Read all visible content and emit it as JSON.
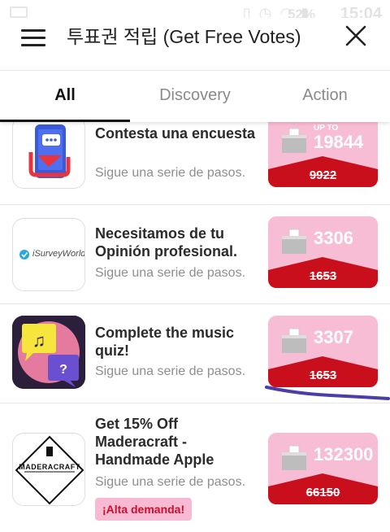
{
  "status_bar": {
    "battery": "52%",
    "time": "15:04"
  },
  "header": {
    "title": "투표권 적립 (Get Free Votes)",
    "menu_icon": "hamburger-icon",
    "close_icon": "close-icon"
  },
  "tabs": [
    {
      "label": "All",
      "active": true
    },
    {
      "label": "Discovery",
      "active": false
    },
    {
      "label": "Action",
      "active": false
    }
  ],
  "offers": [
    {
      "title": "Contesta una encuesta",
      "subtitle": "Sigue una serie de pasos.",
      "prefix": "UP TO",
      "votes": "19844",
      "old_votes": "9922",
      "icon": "phone-chat-icon"
    },
    {
      "title": "Necesitamos de tu Opinión profesional.",
      "subtitle": "Sigue una serie de pasos.",
      "votes": "3306",
      "old_votes": "1653",
      "icon": "isurveyworld-logo",
      "logo_text": "iSurveyWorld"
    },
    {
      "title": "Complete the music quiz!",
      "subtitle": "Sigue una serie de pasos.",
      "votes": "3307",
      "old_votes": "1653",
      "icon": "music-quiz-icon"
    },
    {
      "title": "Get 15% Off Maderacraft - Handmade Apple",
      "subtitle": "Sigue una serie de pasos.",
      "votes": "132300",
      "old_votes": "66150",
      "icon": "maderacraft-logo",
      "logo_text": "MADERACRAFT",
      "badge": "¡Alta demanda!"
    }
  ],
  "colors": {
    "card_pink": "#f7bdd5",
    "card_red": "#c90f1c",
    "badge_pink": "#f8b9d2",
    "annotation_stroke": "#4a3fa8"
  }
}
